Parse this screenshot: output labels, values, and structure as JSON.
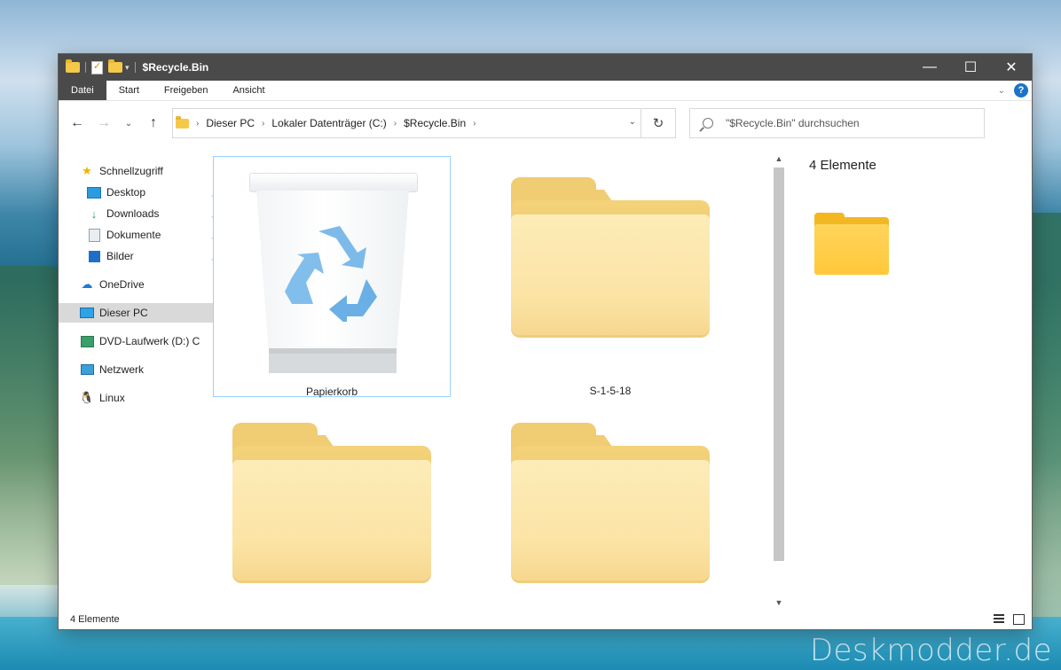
{
  "window": {
    "title": "$Recycle.Bin",
    "controls": {
      "minimize": "—",
      "maximize": "☐",
      "close": "✕"
    }
  },
  "ribbon": {
    "tabs": [
      "Datei",
      "Start",
      "Freigeben",
      "Ansicht"
    ],
    "help": "?"
  },
  "nav": {
    "back": "←",
    "forward": "→",
    "recent": "⌄",
    "up": "↑"
  },
  "address": {
    "crumbs": [
      "Dieser PC",
      "Lokaler Datenträger (C:)",
      "$Recycle.Bin"
    ],
    "refresh": "↻"
  },
  "search": {
    "placeholder": "\"$Recycle.Bin\" durchsuchen"
  },
  "sidebar": {
    "items": [
      {
        "label": "Schnellzugriff",
        "icon": "star-icon"
      },
      {
        "label": "Desktop",
        "icon": "desktop-icon",
        "pinned": true
      },
      {
        "label": "Downloads",
        "icon": "download-icon",
        "pinned": true
      },
      {
        "label": "Dokumente",
        "icon": "document-icon",
        "pinned": true
      },
      {
        "label": "Bilder",
        "icon": "pictures-icon",
        "pinned": true
      },
      {
        "label": "OneDrive",
        "icon": "cloud-icon"
      },
      {
        "label": "Dieser PC",
        "icon": "monitor-icon",
        "selected": true
      },
      {
        "label": "DVD-Laufwerk (D:) C",
        "icon": "dvd-icon"
      },
      {
        "label": "Netzwerk",
        "icon": "network-icon"
      },
      {
        "label": "Linux",
        "icon": "penguin-icon"
      }
    ]
  },
  "files": [
    {
      "name": "Papierkorb",
      "type": "recycle-bin",
      "selected": true
    },
    {
      "name": "S-1-5-18",
      "type": "folder"
    },
    {
      "name": "",
      "type": "folder"
    },
    {
      "name": "",
      "type": "folder"
    }
  ],
  "details": {
    "count": "4 Elemente"
  },
  "status": {
    "count": "4 Elemente"
  },
  "scrollbar": {
    "up": "▲",
    "down": "▼"
  },
  "watermark": "Deskmodder.de",
  "colors": {
    "accent": "#1a73c8",
    "folder": "#f4c94a",
    "selection": "#99d1ff"
  }
}
